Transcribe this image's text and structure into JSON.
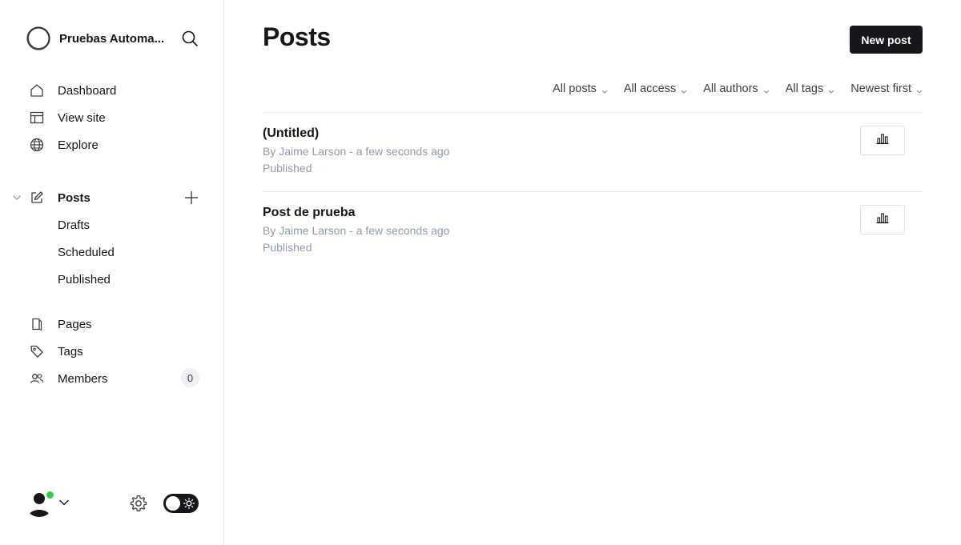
{
  "brand": {
    "name": "Pruebas Automa...",
    "logo_icon": "ring-logo-icon"
  },
  "sidebar": {
    "nav": [
      {
        "label": "Dashboard",
        "icon": "home-icon"
      },
      {
        "label": "View site",
        "icon": "layout-icon"
      },
      {
        "label": "Explore",
        "icon": "globe-icon"
      }
    ],
    "posts": {
      "label": "Posts",
      "icon": "edit-icon",
      "sub_items": [
        "Drafts",
        "Scheduled",
        "Published"
      ]
    },
    "secondary": [
      {
        "label": "Pages",
        "icon": "page-icon"
      },
      {
        "label": "Tags",
        "icon": "tag-icon"
      },
      {
        "label": "Members",
        "icon": "members-icon",
        "badge": "0"
      }
    ]
  },
  "main": {
    "title": "Posts",
    "new_post_label": "New post",
    "filters": [
      "All posts",
      "All access",
      "All authors",
      "All tags",
      "Newest first"
    ],
    "posts": [
      {
        "title": "(Untitled)",
        "meta": "By Jaime Larson - a few seconds ago",
        "status": "Published"
      },
      {
        "title": "Post de prueba",
        "meta": "By Jaime Larson - a few seconds ago",
        "status": "Published"
      }
    ]
  },
  "colors": {
    "accent": "#15171a",
    "online": "#30cf43",
    "muted": "#8e9cac",
    "border": "#e6e9eb"
  }
}
